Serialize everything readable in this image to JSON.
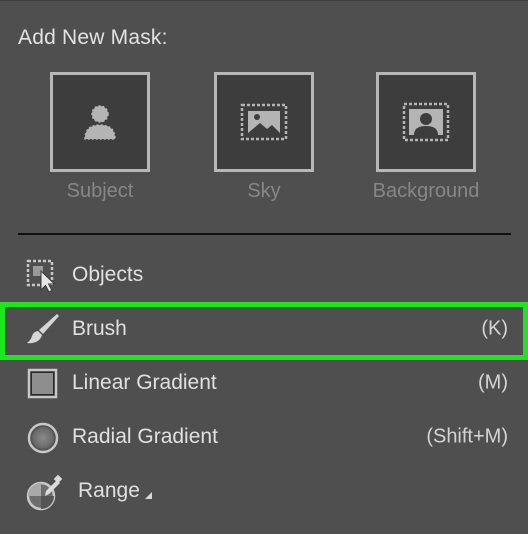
{
  "panel": {
    "heading": "Add New Mask:"
  },
  "tiles": [
    {
      "label": "Subject",
      "icon": "subject-icon"
    },
    {
      "label": "Sky",
      "icon": "sky-icon"
    },
    {
      "label": "Background",
      "icon": "background-icon"
    }
  ],
  "tools": [
    {
      "label": "Objects",
      "shortcut": "",
      "icon": "objects-icon"
    },
    {
      "label": "Brush",
      "shortcut": "(K)",
      "icon": "brush-icon",
      "highlighted": true
    },
    {
      "label": "Linear Gradient",
      "shortcut": "(M)",
      "icon": "linear-gradient-icon"
    },
    {
      "label": "Radial Gradient",
      "shortcut": "(Shift+M)",
      "icon": "radial-gradient-icon"
    },
    {
      "label": "Range",
      "shortcut": "",
      "icon": "range-icon",
      "has_submenu": true
    }
  ],
  "colors": {
    "panel_bg": "#4f4f4f",
    "tile_bg": "#3d3d3d",
    "tile_border": "#b7b7b7",
    "highlight": "#1ee61e"
  }
}
